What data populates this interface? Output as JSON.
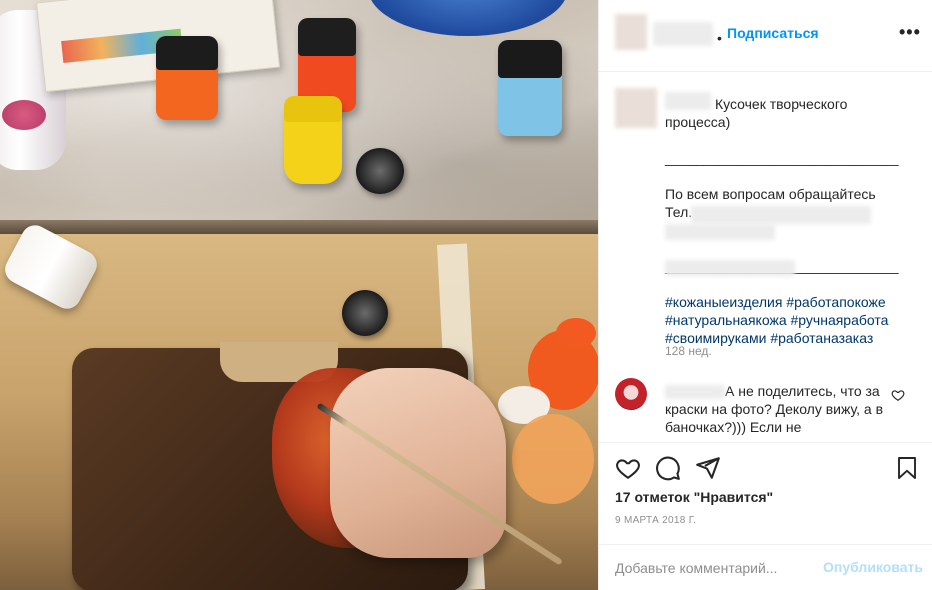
{
  "post": {
    "image_alt": "Painting a leather phone case with acrylic paints"
  },
  "header": {
    "separator": "•",
    "follow_label": "Подписаться",
    "more_label": "•••"
  },
  "caption": {
    "lines": [
      "Кусочек творческого",
      "процесса)",
      "",
      "______________________________",
      "",
      "По всем вопросам обращайтесь",
      "Тел.",
      "",
      "______________________________",
      ""
    ],
    "hashtags": [
      "#кожаныеизделия",
      "#работапокоже",
      "#натуральнаякожа",
      "#ручнаяработа",
      "#своимируками",
      "#работаназаказ"
    ],
    "age": "128 нед."
  },
  "comment": {
    "text": "А не поделитесь, что за краски на фото? Деколу вижу, а в баночках?))) Если не"
  },
  "actions": {
    "likes": "17 отметок \"Нравится\"",
    "date": "9 МАРТА 2018 Г."
  },
  "composer": {
    "placeholder": "Добавьте комментарий...",
    "publish_label": "Опубликовать"
  },
  "colors": {
    "accent": "#0095f6",
    "publish_disabled": "#b2dffc",
    "hashtag": "#00376b"
  },
  "icons": [
    "heart-icon",
    "comment-icon",
    "share-icon",
    "bookmark-icon",
    "more-icon",
    "heart-small-icon"
  ]
}
